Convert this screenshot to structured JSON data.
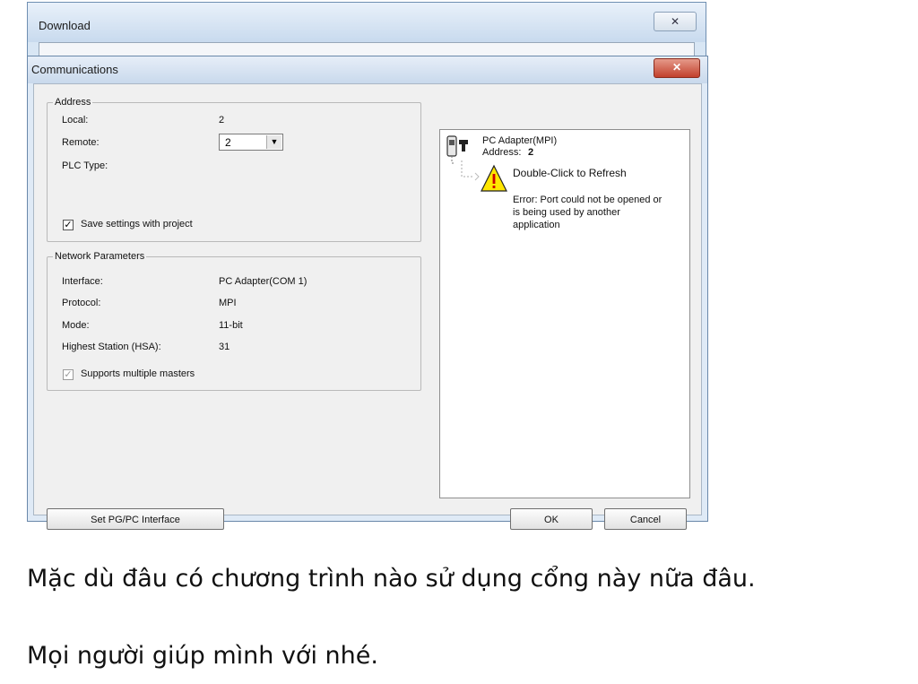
{
  "download_window": {
    "title": "Download",
    "close_label": "✕"
  },
  "dialog": {
    "title": "Communications",
    "close_label": "✕",
    "address": {
      "legend": "Address",
      "local_label": "Local:",
      "local_value": "2",
      "remote_label": "Remote:",
      "remote_value": "2",
      "plc_type_label": "PLC Type:",
      "save_settings_label": "Save settings with project",
      "save_settings_checked": "✓"
    },
    "network": {
      "legend": "Network Parameters",
      "rows": [
        {
          "label": "Interface:",
          "value": "PC Adapter(COM 1)"
        },
        {
          "label": "Protocol:",
          "value": "MPI"
        },
        {
          "label": "Mode:",
          "value": "11-bit"
        },
        {
          "label": "Highest Station (HSA):",
          "value": "31"
        }
      ],
      "multi_master_label": "Supports multiple masters",
      "multi_master_checked": "✓"
    },
    "tree": {
      "adapter_name": "PC Adapter(MPI)",
      "address_label": "Address:",
      "address_value": "2",
      "refresh": "Double-Click to Refresh",
      "error_lines": [
        "Error: Port could not be opened or",
        "is being used by another",
        "application"
      ]
    },
    "buttons": {
      "set_interface": "Set PG/PC Interface",
      "ok": "OK",
      "cancel": "Cancel"
    }
  },
  "captions": [
    "Mặc dù đâu có chương trình nào sử dụng cổng này nữa đâu.",
    "Mọi người giúp mình với nhé."
  ],
  "colors": {
    "dialog_bg": "#f0f0f0",
    "titlebar": "#c9d9ec",
    "close_red": "#c2402c",
    "warning_yellow": "#ffe600"
  }
}
